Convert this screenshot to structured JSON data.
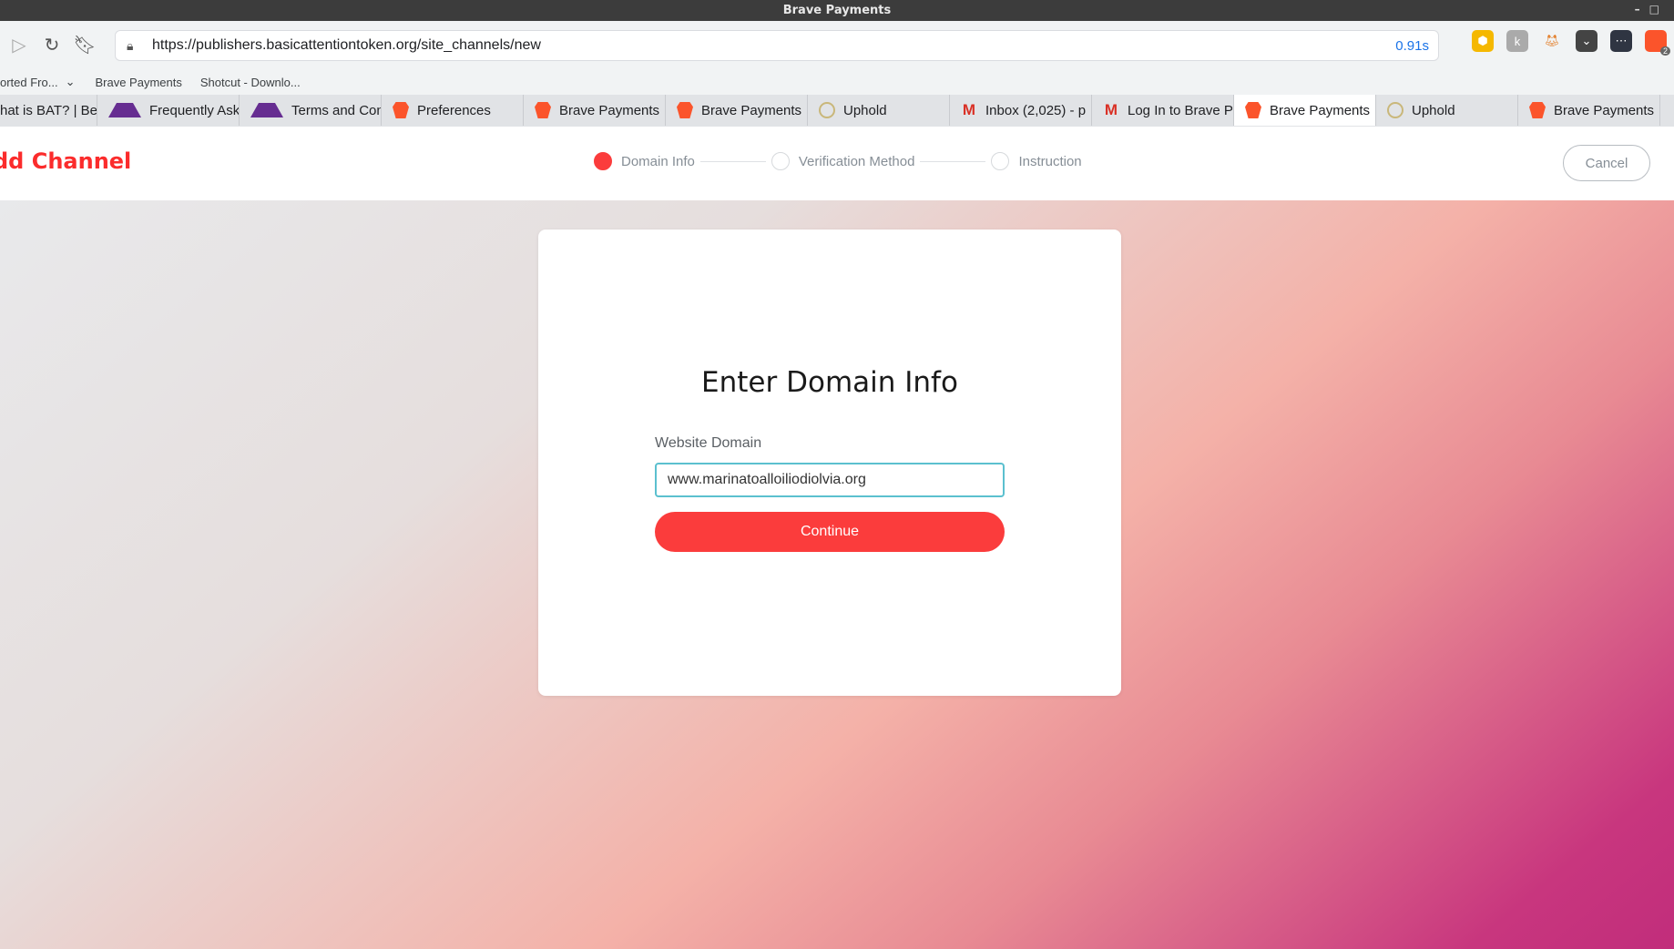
{
  "window": {
    "title": "Brave Payments"
  },
  "toolbar": {
    "url": "https://publishers.basicattentiontoken.org/site_channels/new",
    "load_time": "0.91s",
    "extension_badge": "2"
  },
  "bookmarks": [
    "orted Fro...",
    "Brave Payments",
    "Shotcut - Downlo..."
  ],
  "tabs": [
    {
      "title": "hat is BAT? | Be",
      "icon": "none"
    },
    {
      "title": "Frequently Asked",
      "icon": "bat-triangle-icon"
    },
    {
      "title": "Terms and Condi",
      "icon": "bat-triangle-icon"
    },
    {
      "title": "Preferences",
      "icon": "brave-lion-icon"
    },
    {
      "title": "Brave Payments",
      "icon": "brave-lion-icon"
    },
    {
      "title": "Brave Payments",
      "icon": "brave-lion-icon"
    },
    {
      "title": "Uphold",
      "icon": "uphold-icon"
    },
    {
      "title": "Inbox (2,025) - p",
      "icon": "gmail-icon"
    },
    {
      "title": "Log In to Brave P",
      "icon": "gmail-icon"
    },
    {
      "title": "Brave Payments",
      "icon": "brave-lion-icon",
      "active": true
    },
    {
      "title": "Uphold",
      "icon": "uphold-icon"
    },
    {
      "title": "Brave Payments",
      "icon": "brave-lion-icon"
    }
  ],
  "header": {
    "brand": "dd Channel",
    "steps": [
      "Domain Info",
      "Verification Method",
      "Instruction"
    ],
    "active_step": 0,
    "cancel_label": "Cancel"
  },
  "form": {
    "title": "Enter Domain Info",
    "field_label": "Website Domain",
    "field_value": "www.marinatoalloiliodiolvia.org",
    "submit_label": "Continue"
  },
  "colors": {
    "accent": "#fb3c3c",
    "input_focus": "#5bc0cf"
  }
}
